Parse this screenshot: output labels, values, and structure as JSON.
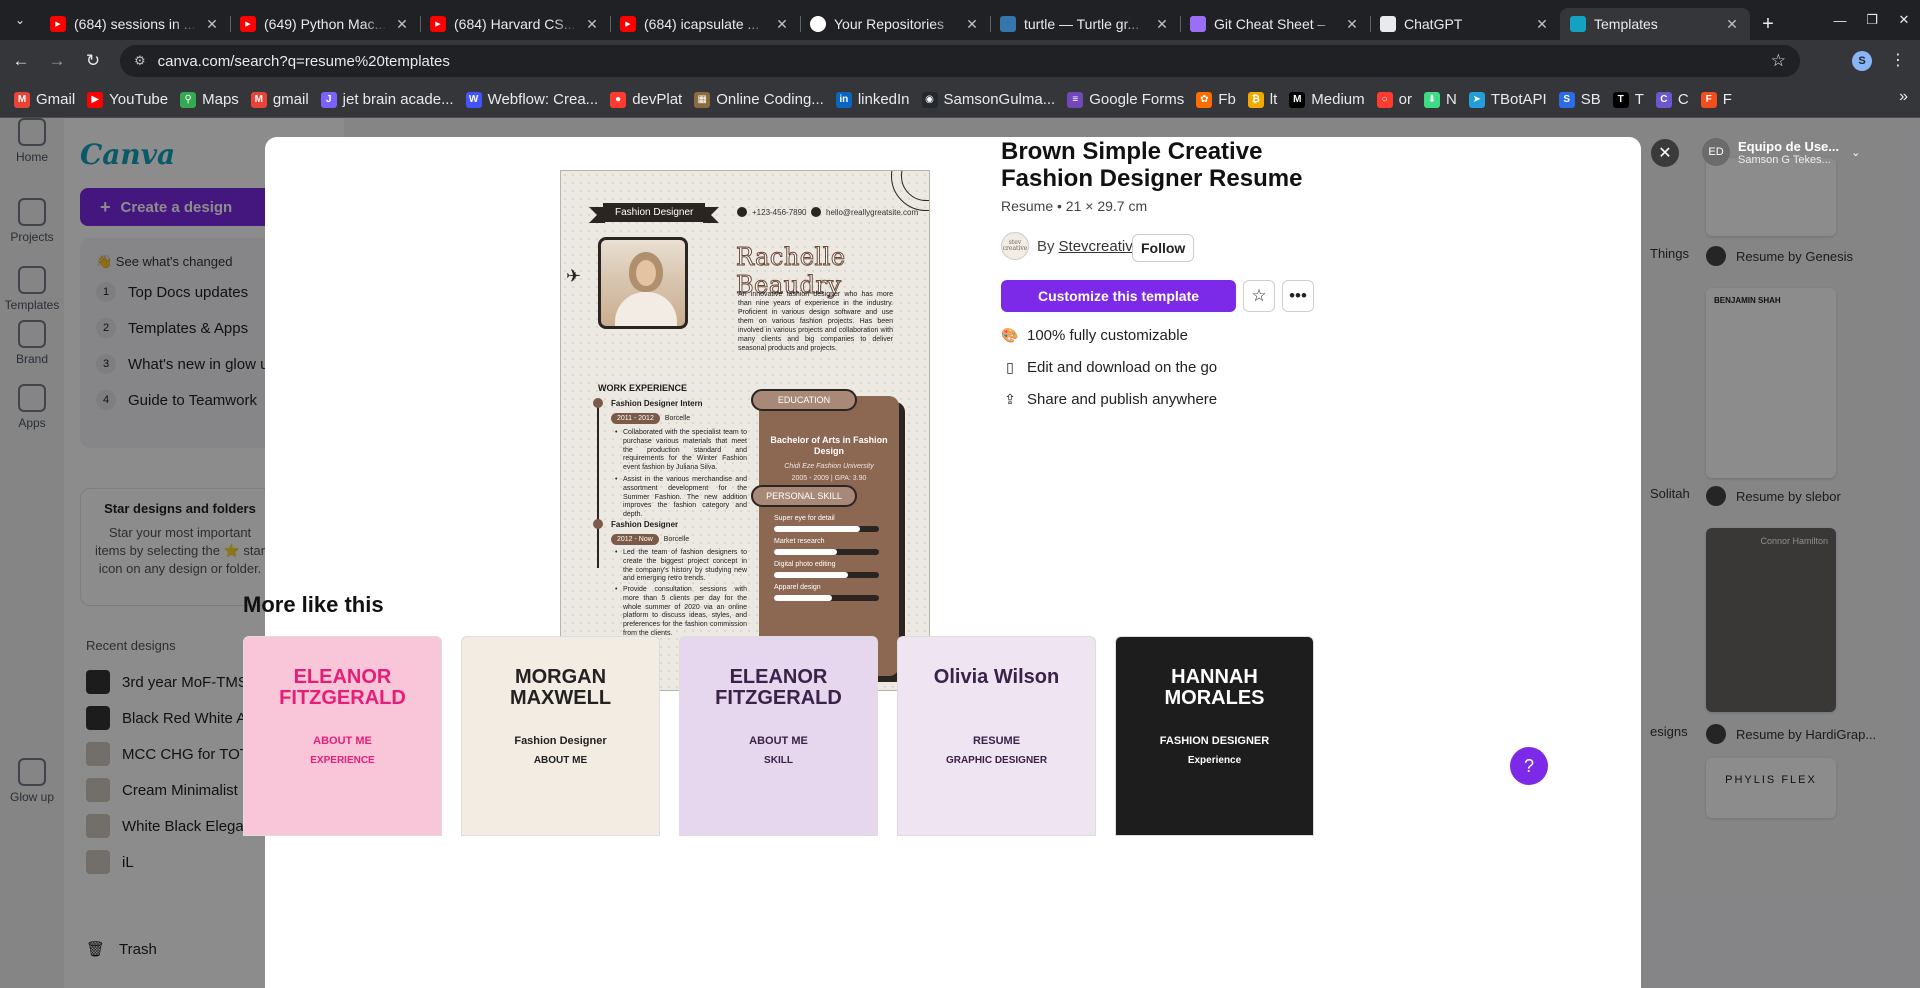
{
  "browser": {
    "tabs": [
      {
        "title": "(684) sessions in ...",
        "icon": "youtube-icon",
        "color": "#ff0000"
      },
      {
        "title": "(649) Python Mac...",
        "icon": "youtube-icon",
        "color": "#ff0000"
      },
      {
        "title": "(684) Harvard CS...",
        "icon": "youtube-icon",
        "color": "#ff0000"
      },
      {
        "title": "(684) icapsulate ...",
        "icon": "youtube-icon",
        "color": "#ff0000"
      },
      {
        "title": "Your Repositories",
        "icon": "github-icon",
        "color": "#ffffff"
      },
      {
        "title": "turtle — Turtle gr...",
        "icon": "python-icon",
        "color": "#3776ab"
      },
      {
        "title": "Git Cheat Sheet –",
        "icon": "git-icon",
        "color": "#9b6ef3"
      },
      {
        "title": "ChatGPT",
        "icon": "chatgpt-icon",
        "color": "#e8eaed"
      },
      {
        "title": "Templates",
        "icon": "canva-icon",
        "color": "#13a3c0",
        "active": true
      }
    ],
    "url": "canva.com/search?q=resume%20templates",
    "profile_initial": "S",
    "bookmarks": [
      {
        "label": "Gmail",
        "color": "#ea4335",
        "glyph": "M"
      },
      {
        "label": "YouTube",
        "color": "#ff0000",
        "glyph": "▶"
      },
      {
        "label": "Maps",
        "color": "#34a853",
        "glyph": "⚲"
      },
      {
        "label": "gmail",
        "color": "#ea4335",
        "glyph": "M"
      },
      {
        "label": "jet brain acade...",
        "color": "#7b61ff",
        "glyph": "J"
      },
      {
        "label": "Webflow: Crea...",
        "color": "#4353ff",
        "glyph": "W"
      },
      {
        "label": "devPlat",
        "color": "#ff3b30",
        "glyph": "●"
      },
      {
        "label": "Online Coding...",
        "color": "#8b6b3d",
        "glyph": "▦"
      },
      {
        "label": "linkedIn",
        "color": "#0a66c2",
        "glyph": "in"
      },
      {
        "label": "SamsonGulma...",
        "color": "#24292f",
        "glyph": "◉"
      },
      {
        "label": "Google Forms",
        "color": "#7248b9",
        "glyph": "≡"
      },
      {
        "label": "Fb",
        "color": "#ff6d00",
        "glyph": "✿"
      },
      {
        "label": "lt",
        "color": "#f2a900",
        "glyph": "₿"
      },
      {
        "label": "Medium",
        "color": "#000000",
        "glyph": "M"
      },
      {
        "label": "or",
        "color": "#ff3b30",
        "glyph": "○"
      },
      {
        "label": "N",
        "color": "#3ddc84",
        "glyph": "⬇"
      },
      {
        "label": "TBotAPI",
        "color": "#229ed9",
        "glyph": "➤"
      },
      {
        "label": "SB",
        "color": "#2b6de8",
        "glyph": "S"
      },
      {
        "label": "T",
        "color": "#000000",
        "glyph": "T"
      },
      {
        "label": "C",
        "color": "#6e56cf",
        "glyph": "C"
      },
      {
        "label": "F",
        "color": "#f24e1e",
        "glyph": "F"
      }
    ]
  },
  "canva": {
    "logo": "Canva",
    "rail": [
      {
        "label": "Home",
        "icon": "home-icon"
      },
      {
        "label": "Projects",
        "icon": "folder-icon"
      },
      {
        "label": "Templates",
        "icon": "templates-icon"
      },
      {
        "label": "Brand",
        "icon": "brand-icon"
      },
      {
        "label": "Apps",
        "icon": "apps-icon"
      },
      {
        "label": "Glow up",
        "icon": "glow-up-icon"
      }
    ],
    "create_button": "Create a design",
    "whats_new": {
      "heading": "👋 See what's changed",
      "items": [
        "Top Docs updates",
        "Templates & Apps",
        "What's new in glow up",
        "Guide to Teamwork"
      ]
    },
    "star_box": {
      "title": "Star designs and folders",
      "text": "Star your most important items by selecting the ⭐ star icon on any design or folder."
    },
    "recent_heading": "Recent designs",
    "recent": [
      "3rd year MoF-TMS Int...",
      "Black Red White Acid...",
      "MCC CHG for TOT Tra...",
      "Cream Minimalist Ele...",
      "White Black Elegant ...",
      "iL"
    ],
    "trash": "Trash",
    "account": {
      "initials": "ED",
      "name": "Equipo de Use...",
      "sub": "Samson G Tekes..."
    },
    "right_labels": [
      "Resume by Genesis",
      "Resume by slebor",
      "Resume by HardiGrap..."
    ],
    "right_partial": [
      "Things",
      "Solitah",
      "esigns"
    ],
    "right_card_names": [
      "BENJAMIN SHAH",
      "Connor Hamilton",
      "PHYLIS FLEX"
    ]
  },
  "modal": {
    "title": "Brown Simple Creative Fashion Designer Resume",
    "meta": "Resume • 21 × 29.7 cm",
    "by": "By",
    "author": "Stevcreative",
    "author_avatar": "stev creative",
    "follow": "Follow",
    "customize": "Customize this template",
    "features": [
      {
        "icon": "palette-icon",
        "glyph": "🎨",
        "text": "100% fully customizable"
      },
      {
        "icon": "phone-icon",
        "glyph": "▯",
        "text": "Edit and download on the go"
      },
      {
        "icon": "share-icon",
        "glyph": "⇪",
        "text": "Share and publish anywhere"
      }
    ],
    "more_heading": "More like this",
    "more_cards": [
      {
        "name": "ELEANOR FITZGERALD",
        "sub": "ABOUT ME",
        "sub2": "EXPERIENCE",
        "bg": "#f8c6d8",
        "fg": "#e61e78"
      },
      {
        "name": "MORGAN MAXWELL",
        "sub": "Fashion Designer",
        "sub2": "ABOUT ME",
        "bg": "#f3ece2",
        "fg": "#222222"
      },
      {
        "name": "ELEANOR FITZGERALD",
        "sub": "ABOUT ME",
        "sub2": "SKILL",
        "bg": "#e6d6ee",
        "fg": "#3a2248"
      },
      {
        "name": "Olivia Wilson",
        "sub": "RESUME",
        "sub2": "GRAPHIC DESIGNER",
        "bg": "#efe4f1",
        "fg": "#3a2248"
      },
      {
        "name": "HANNAH MORALES",
        "sub": "FASHION DESIGNER",
        "sub2": "Experience",
        "bg": "#1d1d1d",
        "fg": "#ffffff"
      }
    ]
  },
  "resume": {
    "tag": "Fashion Designer",
    "phone": "+123-456-7890",
    "email": "hello@reallygreatsite.com",
    "name": "Rachelle Beaudry",
    "summary": "An innovative fashion designer who has more than nine years of experience in the industry. Proficient in various design software and use them on various fashion projects. Has been involved in various projects and collaboration with many clients and big companies to deliver seasonal products and projects.",
    "work_heading": "WORK EXPERIENCE",
    "jobs": [
      {
        "title": "Fashion Designer Intern",
        "years": "2011 - 2012",
        "place": "Borcelle",
        "bullets": [
          "Collaborated with the specialist team to purchase various materials that meet the production standard and requirements for the Winter Fashion event fashion by Juliana Silva.",
          "Assist in the various merchandise and assortment development for the Summer Fashion. The new addition improves the fashion category and depth."
        ]
      },
      {
        "title": "Fashion Designer",
        "years": "2012 - Now",
        "place": "Borcelle",
        "bullets": [
          "Led the team of fashion designers to create the biggest project concept in the company's history by studying new and emerging retro trends.",
          "Provide consultation sessions with more than 5 clients per day for the whole summer of 2020 via an online platform to discuss ideas, styles, and preferences for the fashion commission from the clients."
        ]
      }
    ],
    "education_heading": "EDUCATION",
    "degree": "Bachelor of Arts in Fashion Design",
    "school": "Chidi Eze Fashion University",
    "edu_years": "2005 - 2009 | GPA: 3.90",
    "skill_heading": "PERSONAL SKILL",
    "skills": [
      {
        "name": "Super eye for detail",
        "level": 0.82
      },
      {
        "name": "Market research",
        "level": 0.6
      },
      {
        "name": "Digital photo editing",
        "level": 0.7
      },
      {
        "name": "Apparel design",
        "level": 0.55
      }
    ]
  }
}
